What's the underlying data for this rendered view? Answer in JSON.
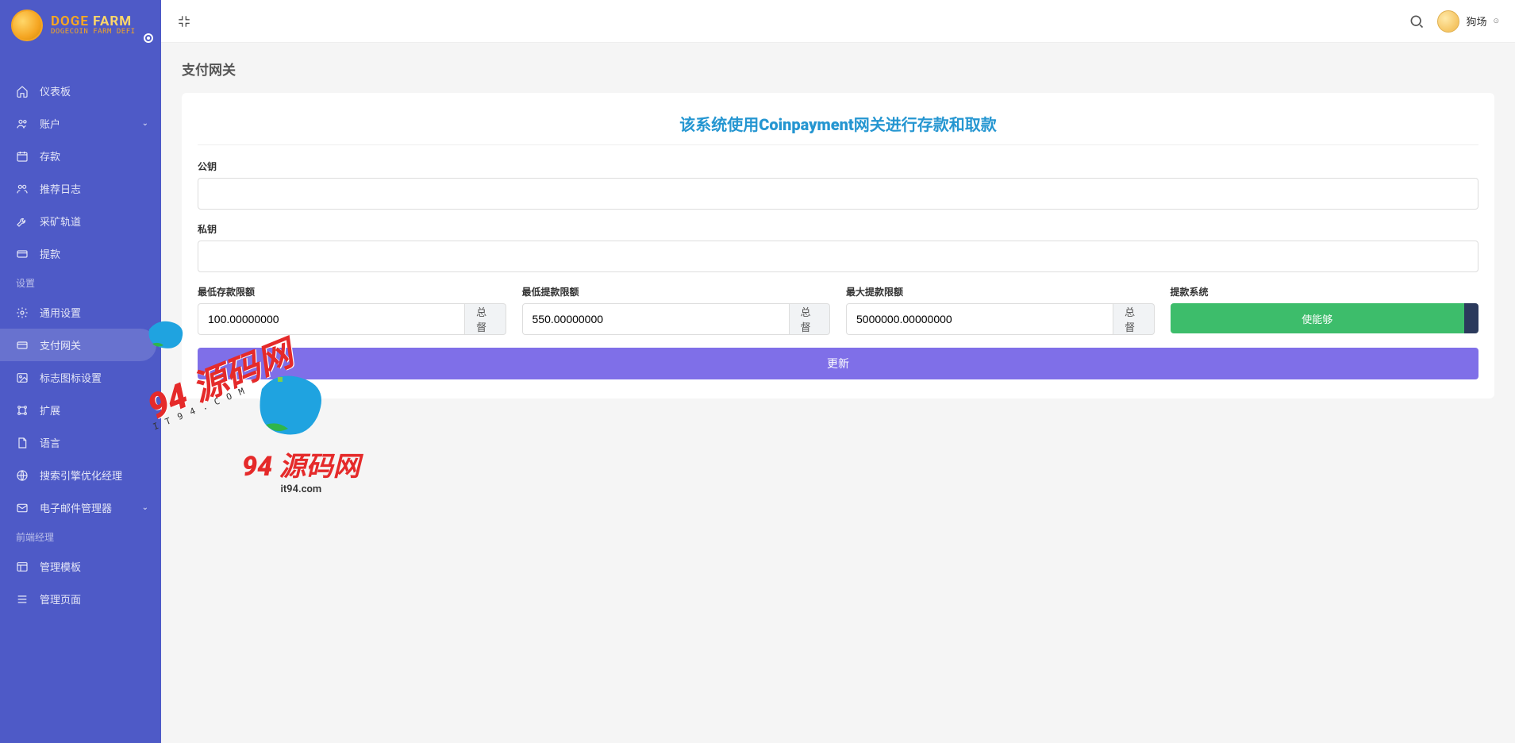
{
  "logo": {
    "title1": "DOGE",
    "title2": "FARM",
    "subtitle": "DOGECOIN FARM DEFI"
  },
  "sidebar": {
    "items": [
      {
        "label": "仪表板",
        "icon": "home"
      },
      {
        "label": "账户",
        "icon": "users",
        "chevron": true
      },
      {
        "label": "存款",
        "icon": "calendar"
      },
      {
        "label": "推荐日志",
        "icon": "people"
      },
      {
        "label": "采矿轨道",
        "icon": "wrench"
      },
      {
        "label": "提款",
        "icon": "card"
      }
    ],
    "section2_title": "设置",
    "section2": [
      {
        "label": "通用设置",
        "icon": "gear"
      },
      {
        "label": "支付网关",
        "icon": "card",
        "active": true
      },
      {
        "label": "标志图标设置",
        "icon": "image"
      },
      {
        "label": "扩展",
        "icon": "nodes"
      },
      {
        "label": "语言",
        "icon": "doc"
      },
      {
        "label": "搜索引擎优化经理",
        "icon": "globe"
      },
      {
        "label": "电子邮件管理器",
        "icon": "mail",
        "chevron": true
      }
    ],
    "section3_title": "前端经理",
    "section3": [
      {
        "label": "管理模板",
        "icon": "layout"
      },
      {
        "label": "管理页面",
        "icon": "menu"
      }
    ]
  },
  "header": {
    "user_name": "狗场"
  },
  "page": {
    "title": "支付网关"
  },
  "form": {
    "heading_prefix": "该系统使用",
    "heading_bold": "Coinpayment",
    "heading_suffix": "网关进行存款和取款",
    "public_key_label": "公钥",
    "public_key_value": "",
    "private_key_label": "私钥",
    "private_key_value": "",
    "min_deposit_label": "最低存款限额",
    "min_deposit_value": "100.00000000",
    "min_withdraw_label": "最低提款限额",
    "min_withdraw_value": "550.00000000",
    "max_withdraw_label": "最大提款限额",
    "max_withdraw_value": "5000000.00000000",
    "addon_text": "总督",
    "withdraw_system_label": "提款系统",
    "withdraw_system_btn": "使能够",
    "submit_label": "更新"
  },
  "watermark": {
    "text": "94 源码网",
    "sub1": "IT94.COM",
    "sub2": "it94.com"
  }
}
